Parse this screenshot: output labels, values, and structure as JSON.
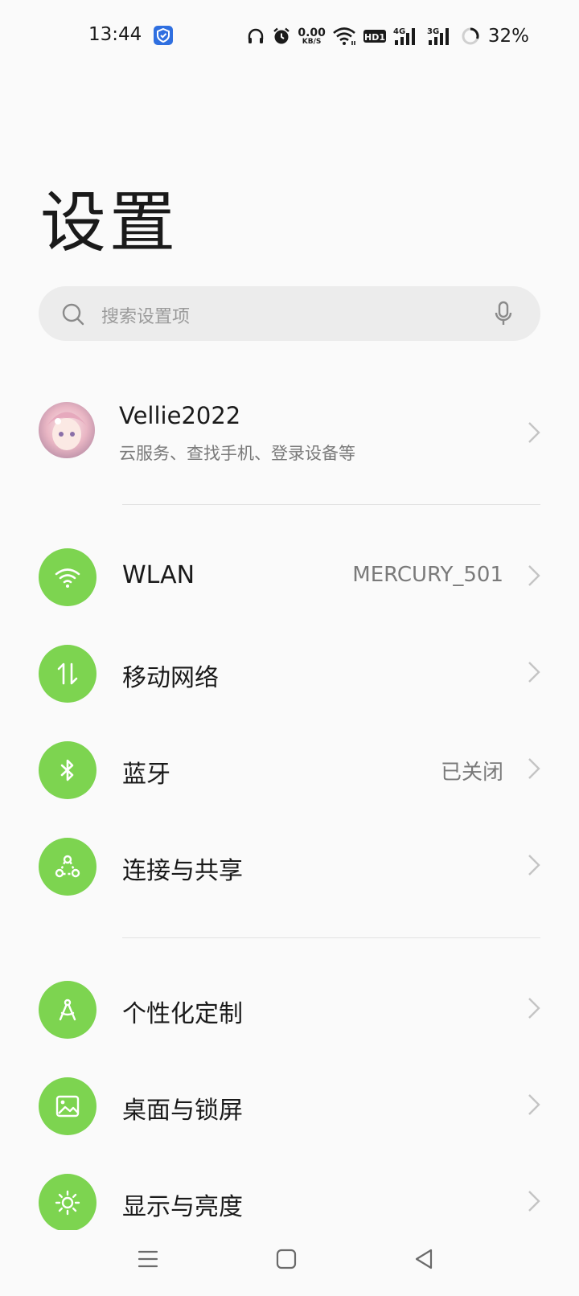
{
  "status_bar": {
    "time": "13:44",
    "net_speed_value": "0.00",
    "net_speed_unit": "KB/S",
    "sim1_type": "4G",
    "sim2_type": "3G",
    "hd_badge": "HD1",
    "battery": "32%"
  },
  "page": {
    "title": "设置"
  },
  "search": {
    "placeholder": "搜索设置项"
  },
  "account": {
    "name": "Vellie2022",
    "subtitle": "云服务、查找手机、登录设备等"
  },
  "groups": [
    {
      "items": [
        {
          "label": "WLAN",
          "value": "MERCURY_501",
          "icon": "wifi-icon"
        },
        {
          "label": "移动网络",
          "value": "",
          "icon": "mobile-data-icon"
        },
        {
          "label": "蓝牙",
          "value": "已关闭",
          "icon": "bluetooth-icon"
        },
        {
          "label": "连接与共享",
          "value": "",
          "icon": "share-icon"
        }
      ]
    },
    {
      "items": [
        {
          "label": "个性化定制",
          "value": "",
          "icon": "compass-icon"
        },
        {
          "label": "桌面与锁屏",
          "value": "",
          "icon": "picture-icon"
        },
        {
          "label": "显示与亮度",
          "value": "",
          "icon": "brightness-icon"
        }
      ]
    }
  ],
  "colors": {
    "accent": "#7dd450",
    "background": "#fafafa",
    "search_bg": "#ececec"
  }
}
